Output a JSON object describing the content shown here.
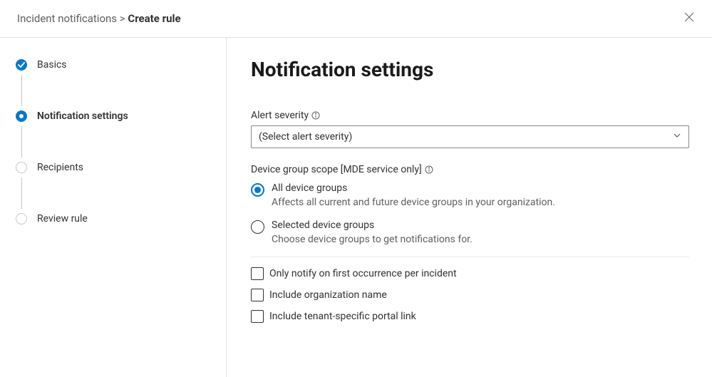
{
  "breadcrumb": {
    "parent": "Incident notifications",
    "separator": ">",
    "current": "Create rule"
  },
  "steps": [
    {
      "label": "Basics",
      "state": "completed"
    },
    {
      "label": "Notification settings",
      "state": "current"
    },
    {
      "label": "Recipients",
      "state": "pending"
    },
    {
      "label": "Review rule",
      "state": "pending"
    }
  ],
  "main": {
    "title": "Notification settings",
    "alert_severity": {
      "label": "Alert severity",
      "placeholder": "(Select alert severity)"
    },
    "device_scope": {
      "label": "Device group scope [MDE service only]",
      "options": [
        {
          "label": "All device groups",
          "desc": "Affects all current and future device groups in your organization.",
          "selected": true
        },
        {
          "label": "Selected device groups",
          "desc": "Choose device groups to get notifications for.",
          "selected": false
        }
      ]
    },
    "checkboxes": [
      {
        "label": "Only notify on first occurrence per incident",
        "checked": false
      },
      {
        "label": "Include organization name",
        "checked": false
      },
      {
        "label": "Include tenant-specific portal link",
        "checked": false
      }
    ]
  }
}
